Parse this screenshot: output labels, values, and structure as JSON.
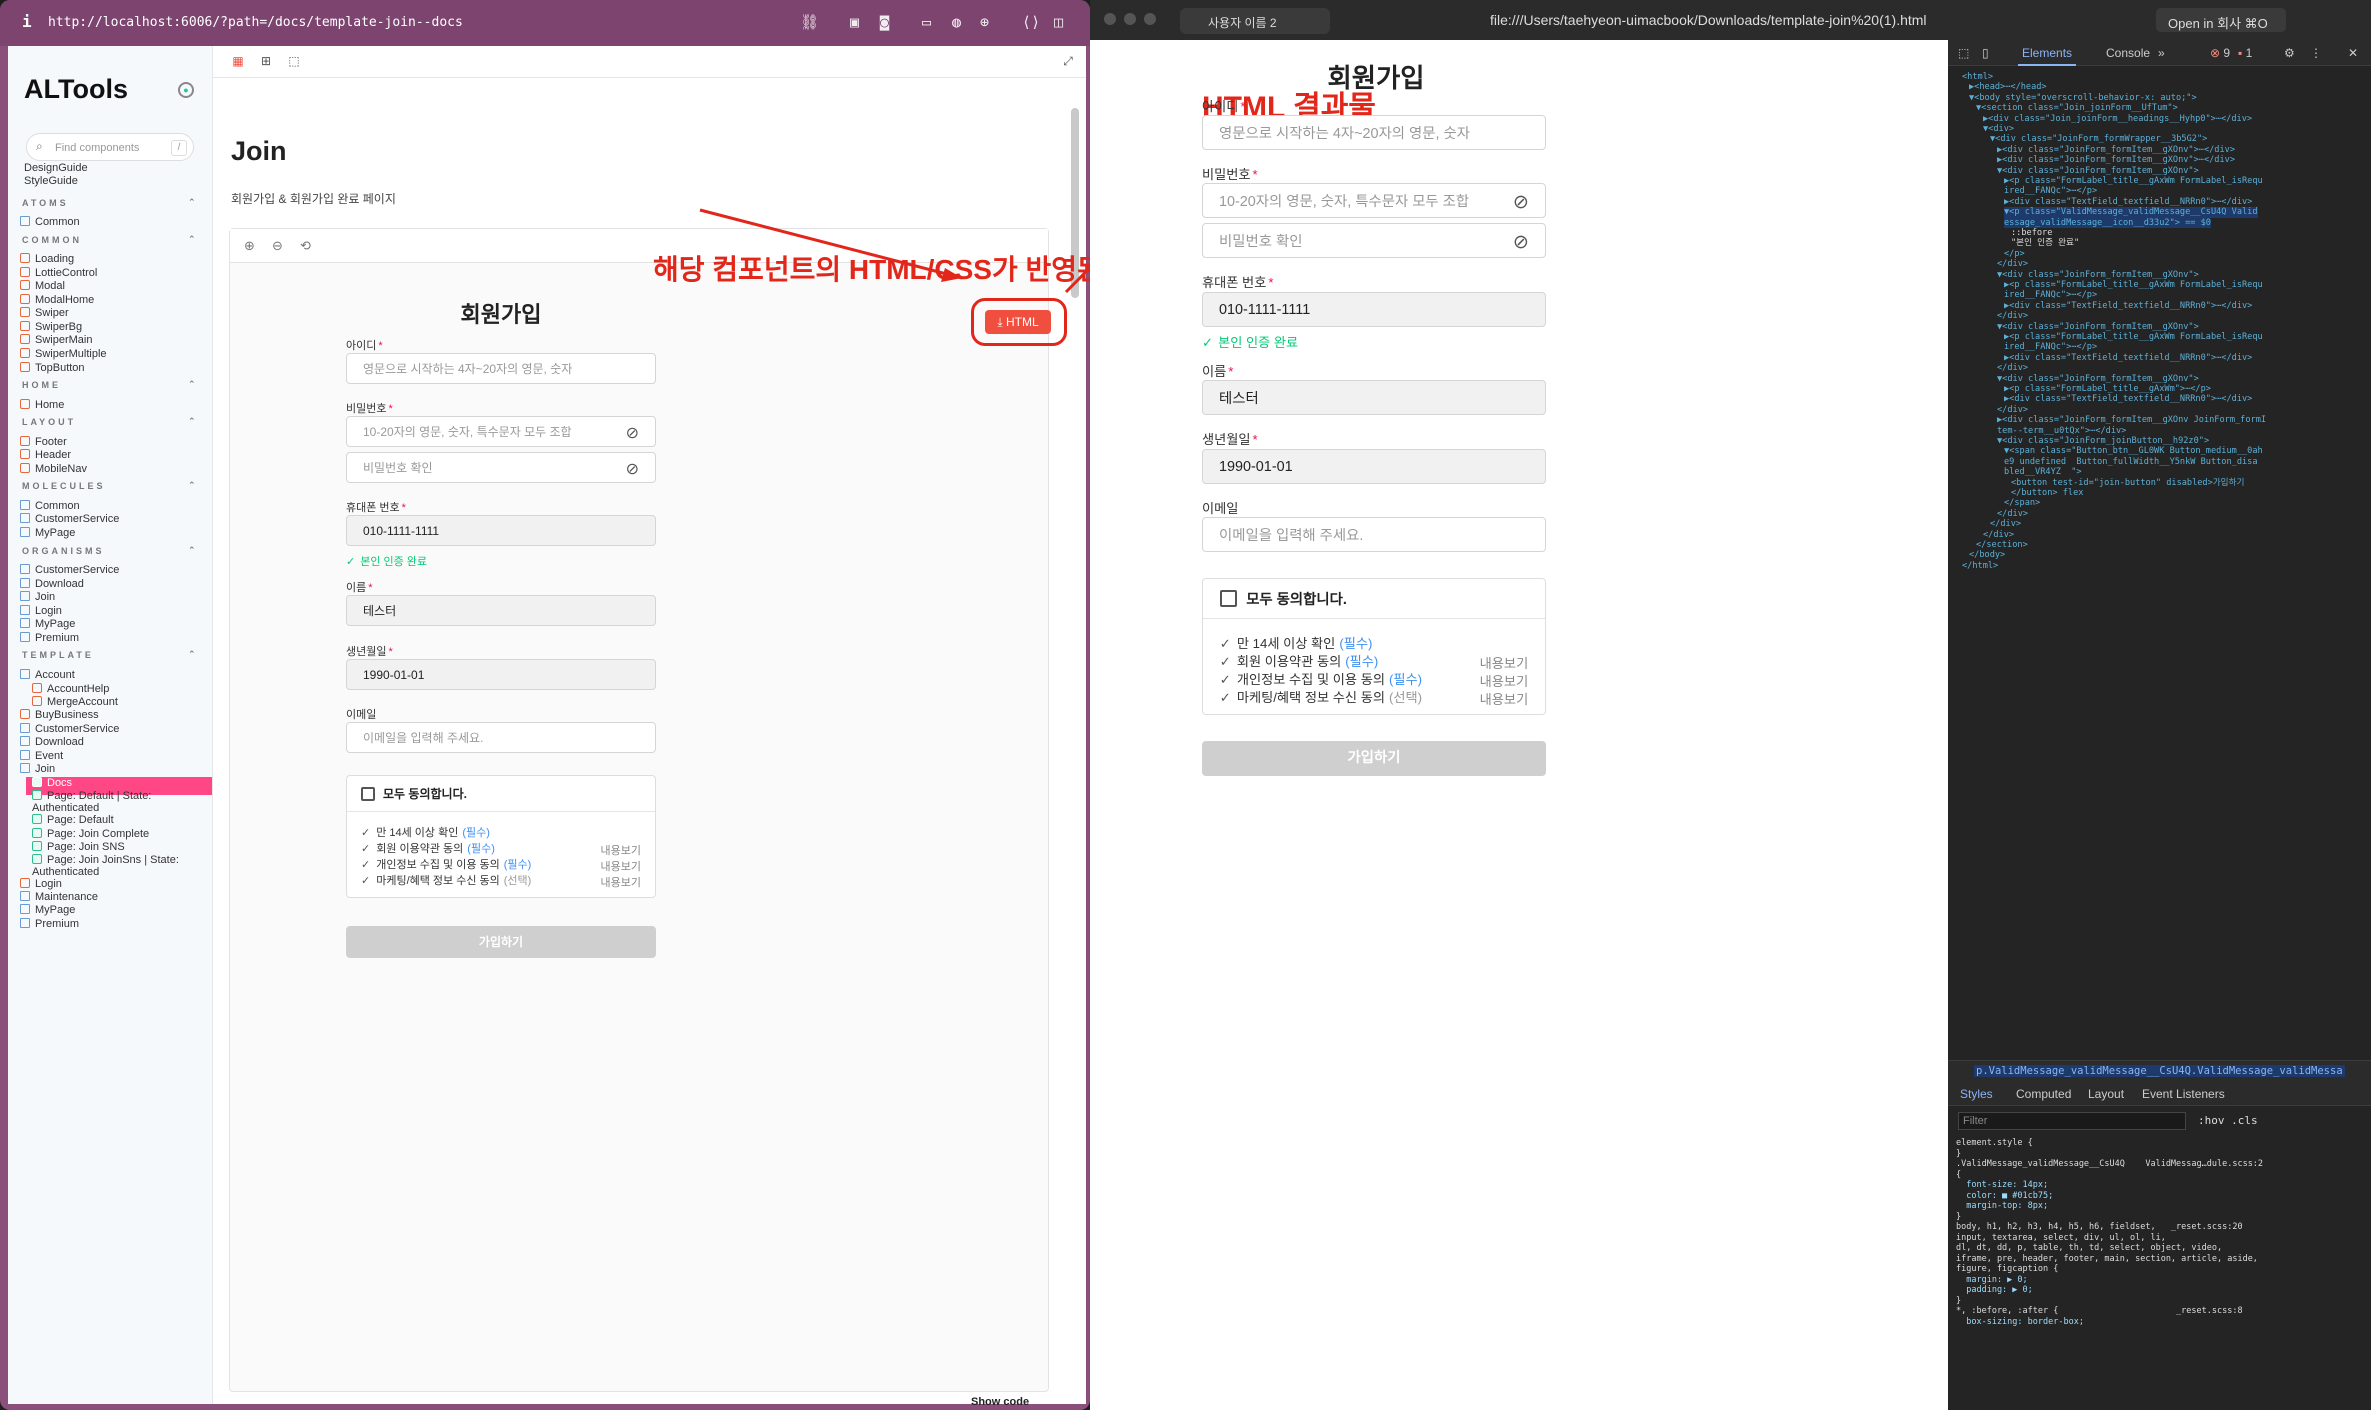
{
  "left_window": {
    "url": "http://localhost:6006/?path=/docs/template-join--docs",
    "info_icon": "i",
    "logo": "ALTools",
    "logo_badge": "●",
    "search_placeholder": "Find components",
    "search_shortcut": "/",
    "root_items": [
      "DesignGuide",
      "StyleGuide"
    ],
    "sections": [
      {
        "title": "ATOMS",
        "items": [
          "Common"
        ]
      },
      {
        "title": "COMMON",
        "items": [
          "Loading",
          "LottieControl",
          "Modal",
          "ModalHome",
          "Swiper",
          "SwiperBg",
          "SwiperMain",
          "SwiperMultiple",
          "TopButton"
        ]
      },
      {
        "title": "HOME",
        "items": [
          "Home"
        ]
      },
      {
        "title": "LAYOUT",
        "items": [
          "Footer",
          "Header",
          "MobileNav"
        ]
      },
      {
        "title": "MOLECULES",
        "items": [
          "Common",
          "CustomerService",
          "MyPage"
        ]
      },
      {
        "title": "ORGANISMS",
        "items": [
          "CustomerService",
          "Download",
          "Join",
          "Login",
          "MyPage",
          "Premium"
        ]
      },
      {
        "title": "TEMPLATE",
        "items": [
          "Account",
          "AccountHelp",
          "MergeAccount",
          "BuyBusiness",
          "CustomerService",
          "Download",
          "Event",
          "Join",
          "Docs",
          "Page: Default | State: Authenticated",
          "Page: Default",
          "Page: Join Complete",
          "Page: Join SNS",
          "Page: Join JoinSns | State: Authenticated",
          "Login",
          "Maintenance",
          "MyPage",
          "Premium"
        ]
      }
    ],
    "selected_item": "Docs",
    "page_title": "Join",
    "page_desc": "회원가입 & 회원가입 완료 페이지",
    "html_button": "⤓ HTML",
    "show_code": "Show code",
    "annotation": "해당 컴포넌트의 HTML/CSS가 반영된 HTML 다운"
  },
  "form": {
    "title": "회원가입",
    "id_label": "아이디",
    "id_placeholder": "영문으로 시작하는 4자~20자의 영문, 숫자",
    "pw_label": "비밀번호",
    "pw_placeholder": "10-20자의 영문, 숫자, 특수문자 모두 조합",
    "pw_confirm_placeholder": "비밀번호 확인",
    "phone_label": "휴대폰 번호",
    "phone_value": "010-1111-1111",
    "phone_valid": "본인 인증 완료",
    "name_label": "이름",
    "name_value": "테스터",
    "birth_label": "생년월일",
    "birth_value": "1990-01-01",
    "email_label": "이메일",
    "email_placeholder": "이메일을 입력해 주세요.",
    "agree_all": "모두 동의합니다.",
    "agree_items": [
      {
        "text": "만 14세 이상 확인",
        "tag": "(필수)",
        "view": ""
      },
      {
        "text": "회원 이용약관 동의",
        "tag": "(필수)",
        "view": "내용보기"
      },
      {
        "text": "개인정보 수집 및 이용 동의",
        "tag": "(필수)",
        "view": "내용보기"
      },
      {
        "text": "마케팅/혜택 정보 수신 동의",
        "tag": "(선택)",
        "view": "내용보기"
      }
    ],
    "submit": "가입하기",
    "required_mark": "*",
    "check_mark": "✓"
  },
  "right_window": {
    "tab_title": "사용자 이름 2",
    "url": "file:///Users/taehyeon-uimacbook/Downloads/template-join%20(1).html",
    "open_in": "Open in 회사 ⌘O",
    "annotation": "HTML 결과물"
  },
  "devtools": {
    "tabs": [
      "Elements",
      "Console"
    ],
    "errors": "9",
    "warnings": "1",
    "dom_lines": [
      {
        "i": 0,
        "t": "<html>"
      },
      {
        "i": 1,
        "t": "▶<head>⋯</head>"
      },
      {
        "i": 1,
        "t": "▼<body style=\"overscroll-behavior-x: auto;\">"
      },
      {
        "i": 2,
        "t": "▼<section class=\"Join_joinForm__UfTum\">"
      },
      {
        "i": 3,
        "t": "▶<div class=\"Join_joinForm__headings__Hyhp0\">⋯</div>"
      },
      {
        "i": 3,
        "t": "▼<div>"
      },
      {
        "i": 4,
        "t": "▼<div class=\"JoinForm_formWrapper__3b5G2\">"
      },
      {
        "i": 5,
        "t": "▶<div class=\"JoinForm_formItem__gXOnv\">⋯</div>"
      },
      {
        "i": 5,
        "t": "▶<div class=\"JoinForm_formItem__gXOnv\">⋯</div>"
      },
      {
        "i": 5,
        "t": "▼<div class=\"JoinForm_formItem__gXOnv\">"
      },
      {
        "i": 6,
        "t": "▶<p class=\"FormLabel_title__gAxWm FormLabel_isRequ"
      },
      {
        "i": 6,
        "t": "ired__FANQc\">⋯</p>"
      },
      {
        "i": 6,
        "t": "▶<div class=\"TextField_textfield__NRRn0\">⋯</div>"
      },
      {
        "i": 6,
        "t": "▼<p class=\"ValidMessage_validMessage__CsU4Q Valid"
      },
      {
        "i": 6,
        "t": "essage_validMessage__icon__d33u2\"> == $0"
      },
      {
        "i": 7,
        "t": "::before"
      },
      {
        "i": 7,
        "t": "\"본인 인증 완료\""
      },
      {
        "i": 6,
        "t": "</p>"
      },
      {
        "i": 5,
        "t": "</div>"
      },
      {
        "i": 5,
        "t": "▼<div class=\"JoinForm_formItem__gXOnv\">"
      },
      {
        "i": 6,
        "t": "▶<p class=\"FormLabel_title__gAxWm FormLabel_isRequ"
      },
      {
        "i": 6,
        "t": "ired__FANQc\">⋯</p>"
      },
      {
        "i": 6,
        "t": "▶<div class=\"TextField_textfield__NRRn0\">⋯</div>"
      },
      {
        "i": 5,
        "t": "</div>"
      },
      {
        "i": 5,
        "t": "▼<div class=\"JoinForm_formItem__gXOnv\">"
      },
      {
        "i": 6,
        "t": "▶<p class=\"FormLabel_title__gAxWm FormLabel_isRequ"
      },
      {
        "i": 6,
        "t": "ired__FANQc\">⋯</p>"
      },
      {
        "i": 6,
        "t": "▶<div class=\"TextField_textfield__NRRn0\">⋯</div>"
      },
      {
        "i": 5,
        "t": "</div>"
      },
      {
        "i": 5,
        "t": "▼<div class=\"JoinForm_formItem__gXOnv\">"
      },
      {
        "i": 6,
        "t": "▶<p class=\"FormLabel_title__gAxWm\">⋯</p>"
      },
      {
        "i": 6,
        "t": "▶<div class=\"TextField_textfield__NRRn0\">⋯</div>"
      },
      {
        "i": 5,
        "t": "</div>"
      },
      {
        "i": 5,
        "t": "▶<div class=\"JoinForm_formItem__gXOnv JoinForm_formI"
      },
      {
        "i": 5,
        "t": "tem--term__u0tQx\">⋯</div>"
      },
      {
        "i": 5,
        "t": "▼<div class=\"JoinForm_joinButton__h92z0\">"
      },
      {
        "i": 6,
        "t": "▼<span class=\"Button_btn__GL0WK Button_medium__0ah"
      },
      {
        "i": 6,
        "t": "e9 undefined  Button_fullWidth__Y5nkW Button_disa"
      },
      {
        "i": 6,
        "t": "bled__VR4YZ  \">"
      },
      {
        "i": 7,
        "t": "<button test-id=\"join-button\" disabled>가입하기"
      },
      {
        "i": 7,
        "t": "</button> flex"
      },
      {
        "i": 6,
        "t": "</span>"
      },
      {
        "i": 5,
        "t": "</div>"
      },
      {
        "i": 4,
        "t": "</div>"
      },
      {
        "i": 3,
        "t": "</div>"
      },
      {
        "i": 2,
        "t": "</section>"
      },
      {
        "i": 1,
        "t": "</body>"
      },
      {
        "i": 0,
        "t": "</html>"
      }
    ],
    "breadcrumb": "p.ValidMessage_validMessage__CsU4Q.ValidMessage_validMessa",
    "style_tabs": [
      "Styles",
      "Computed",
      "Layout",
      "Event Listeners"
    ],
    "filter_placeholder": "Filter",
    "filter_tools": ":hov .cls",
    "css_lines": [
      "element.style {",
      "}",
      ".ValidMessage_validMessage__CsU4Q    ValidMessag…dule.scss:2",
      "{",
      "  font-size: 14px;",
      "  color: ■ #01cb75;",
      "  margin-top: 8px;",
      "}",
      "body, h1, h2, h3, h4, h5, h6, fieldset,   _reset.scss:20",
      "input, textarea, select, div, ul, ol, li,",
      "dl, dt, dd, p, table, th, td, select, object, video,",
      "iframe, pre, header, footer, main, section, article, aside,",
      "figure, figcaption {",
      "  margin: ▶ 0;",
      "  padding: ▶ 0;",
      "}",
      "*, :before, :after {                       _reset.scss:8",
      "  box-sizing: border-box;"
    ]
  }
}
